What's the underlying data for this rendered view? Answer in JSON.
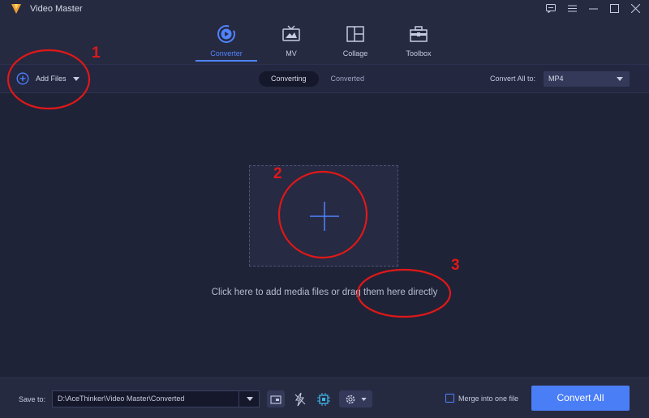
{
  "app": {
    "title": "Video Master"
  },
  "nav": {
    "tabs": [
      {
        "label": "Converter",
        "icon": "converter-icon",
        "active": true
      },
      {
        "label": "MV",
        "icon": "tv-icon",
        "active": false
      },
      {
        "label": "Collage",
        "icon": "collage-icon",
        "active": false
      },
      {
        "label": "Toolbox",
        "icon": "toolbox-icon",
        "active": false
      }
    ]
  },
  "toolbar": {
    "add_files_label": "Add Files",
    "segments": [
      "Converting",
      "Converted"
    ],
    "active_segment": "Converting",
    "convert_all_to_label": "Convert All to:",
    "format_value": "MP4"
  },
  "main": {
    "drop_hint": "Click here to add media files or drag them here directly"
  },
  "annotations": [
    "1",
    "2",
    "3"
  ],
  "footer": {
    "save_to_label": "Save to:",
    "save_path": "D:\\AceThinker\\Video Master\\Converted",
    "merge_label": "Merge into one file",
    "convert_all_label": "Convert All"
  },
  "colors": {
    "background": "#1f2337",
    "accent": "#4f83ff",
    "primary_button": "#4a7ef7",
    "annotation": "#e01818"
  }
}
